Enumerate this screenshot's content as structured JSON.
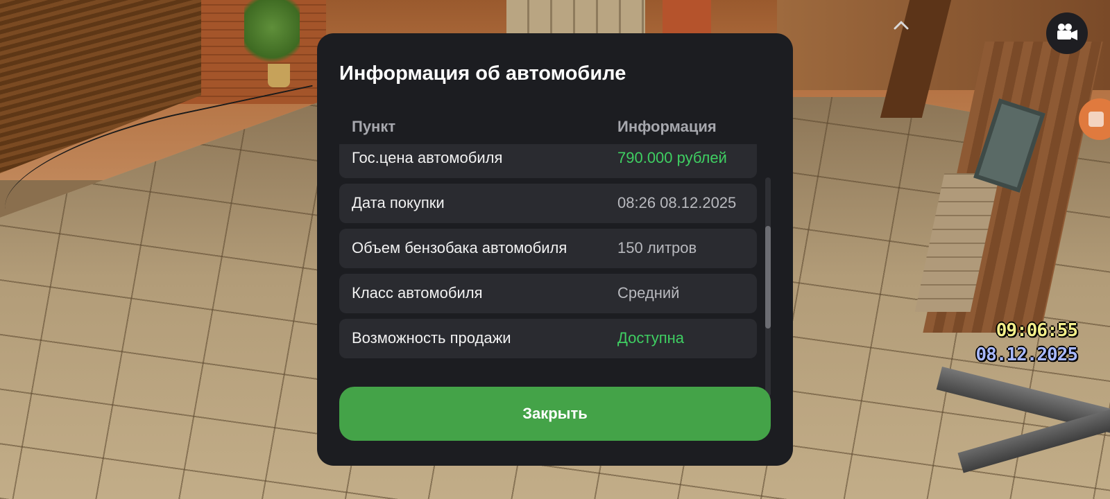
{
  "modal": {
    "title": "Информация об автомобиле",
    "columns": {
      "item": "Пункт",
      "info": "Информация"
    },
    "rows": [
      {
        "label": "Гос.цена автомобиля",
        "value": "790.000 рублей",
        "accent": "green"
      },
      {
        "label": "Дата покупки",
        "value": "08:26 08.12.2025",
        "accent": "gray"
      },
      {
        "label": "Объем бензобака автомобиля",
        "value": "150 литров",
        "accent": "gray"
      },
      {
        "label": "Класс автомобиля",
        "value": "Средний",
        "accent": "gray"
      },
      {
        "label": "Возможность продажи",
        "value": "Доступна",
        "accent": "green"
      }
    ],
    "close_label": "Закрыть"
  },
  "hud": {
    "time": "09:06:55",
    "date": "08.12.2025",
    "camera_icon": "video-camera-icon",
    "record_icon": "record-stop-icon",
    "chevron_icon": "chevron-up-icon"
  },
  "colors": {
    "modal_bg": "#1c1d21",
    "row_bg": "#2a2b30",
    "accent_green": "#3fcf62",
    "button_green": "#44a348",
    "clock_yellow": "#f2ee8a",
    "date_blue": "#a8b8ff"
  }
}
